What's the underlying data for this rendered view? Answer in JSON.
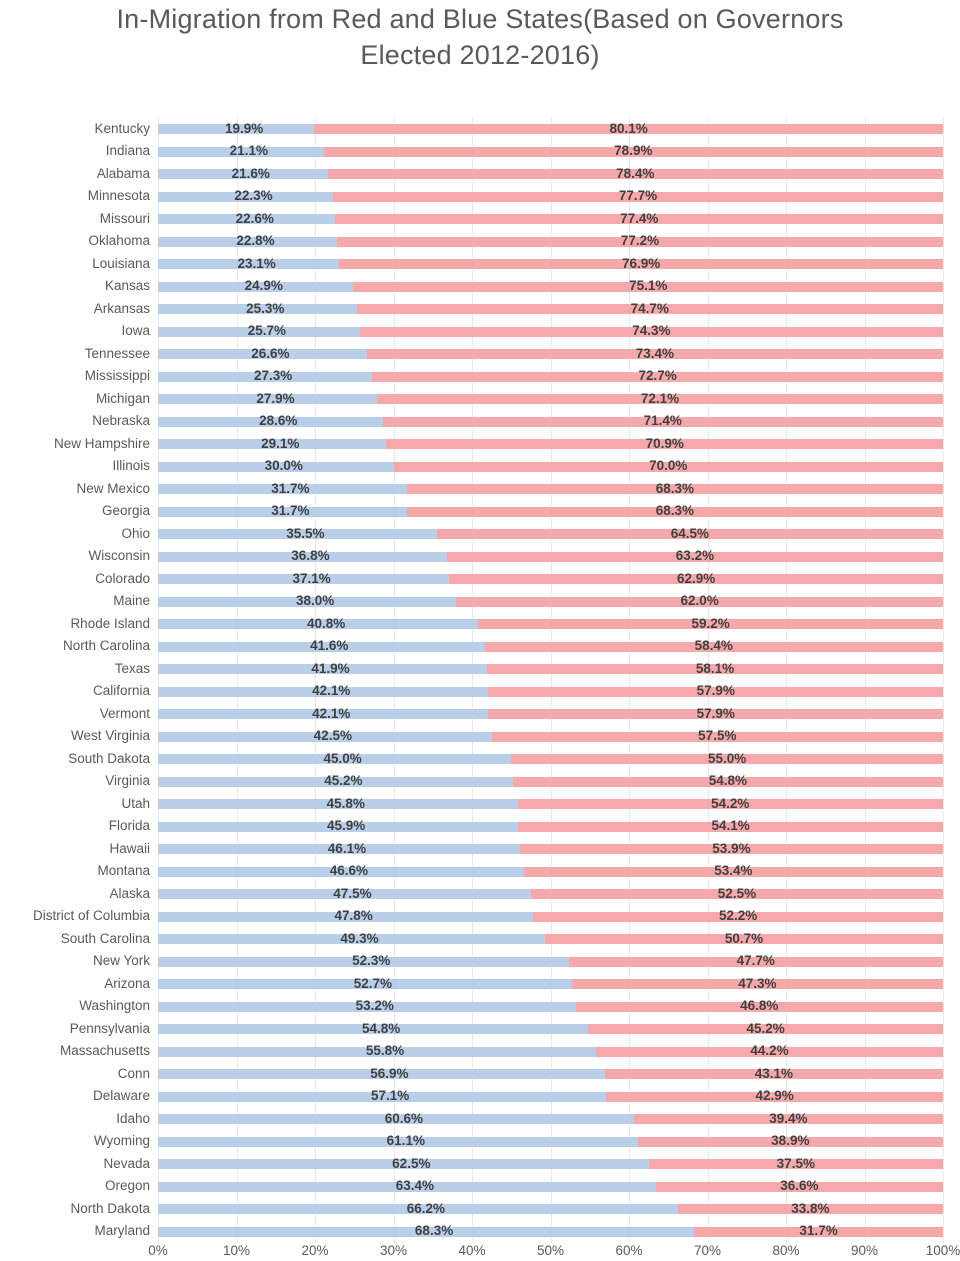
{
  "chart_data": {
    "type": "bar",
    "subtype": "100% stacked horizontal bar",
    "title": "In-Migration from Red and Blue States(Based on Governors Elected 2012-2016)",
    "xlabel": "",
    "ylabel": "",
    "xlim": [
      0,
      100
    ],
    "xticks": [
      "0%",
      "10%",
      "20%",
      "30%",
      "40%",
      "50%",
      "60%",
      "70%",
      "80%",
      "90%",
      "100%"
    ],
    "grid": true,
    "legend": "none",
    "series": [
      {
        "name": "Blue states",
        "color": "#b9cfe9"
      },
      {
        "name": "Red states",
        "color": "#f7a8ab"
      }
    ],
    "categories": [
      "Kentucky",
      "Indiana",
      "Alabama",
      "Minnesota",
      "Missouri",
      "Oklahoma",
      "Louisiana",
      "Kansas",
      "Arkansas",
      "Iowa",
      "Tennessee",
      "Mississippi",
      "Michigan",
      "Nebraska",
      "New Hampshire",
      "Illinois",
      "New Mexico",
      "Georgia",
      "Ohio",
      "Wisconsin",
      "Colorado",
      "Maine",
      "Rhode Island",
      "North Carolina",
      "Texas",
      "California",
      "Vermont",
      "West Virginia",
      "South Dakota",
      "Virginia",
      "Utah",
      "Florida",
      "Hawaii",
      "Montana",
      "Alaska",
      "District of Columbia",
      "South Carolina",
      "New York",
      "Arizona",
      "Washington",
      "Pennsylvania",
      "Massachusetts",
      "Conn",
      "Delaware",
      "Idaho",
      "Wyoming",
      "Nevada",
      "Oregon",
      "North Dakota",
      "Maryland"
    ],
    "blue_values": [
      19.9,
      21.1,
      21.6,
      22.3,
      22.6,
      22.8,
      23.1,
      24.9,
      25.3,
      25.7,
      26.6,
      27.3,
      27.9,
      28.6,
      29.1,
      30.0,
      31.7,
      31.7,
      35.5,
      36.8,
      37.1,
      38.0,
      40.8,
      41.6,
      41.9,
      42.1,
      42.1,
      42.5,
      45.0,
      45.2,
      45.8,
      45.9,
      46.1,
      46.6,
      47.5,
      47.8,
      49.3,
      52.3,
      52.7,
      53.2,
      54.8,
      55.8,
      56.9,
      57.1,
      60.6,
      61.1,
      62.5,
      63.4,
      66.2,
      68.3
    ],
    "red_values": [
      80.1,
      78.9,
      78.4,
      77.7,
      77.4,
      77.2,
      76.9,
      75.1,
      74.7,
      74.3,
      73.4,
      72.7,
      72.1,
      71.4,
      70.9,
      70.0,
      68.3,
      68.3,
      64.5,
      63.2,
      62.9,
      62.0,
      59.2,
      58.4,
      58.1,
      57.9,
      57.9,
      57.5,
      55.0,
      54.8,
      54.2,
      54.1,
      53.9,
      53.4,
      52.5,
      52.2,
      50.7,
      47.7,
      47.3,
      46.8,
      45.2,
      44.2,
      43.1,
      42.9,
      39.4,
      38.9,
      37.5,
      36.6,
      33.8,
      31.7
    ],
    "blue_labels": [
      "19.9%",
      "21.1%",
      "21.6%",
      "22.3%",
      "22.6%",
      "22.8%",
      "23.1%",
      "24.9%",
      "25.3%",
      "25.7%",
      "26.6%",
      "27.3%",
      "27.9%",
      "28.6%",
      "29.1%",
      "30.0%",
      "31.7%",
      "31.7%",
      "35.5%",
      "36.8%",
      "37.1%",
      "38.0%",
      "40.8%",
      "41.6%",
      "41.9%",
      "42.1%",
      "42.1%",
      "42.5%",
      "45.0%",
      "45.2%",
      "45.8%",
      "45.9%",
      "46.1%",
      "46.6%",
      "47.5%",
      "47.8%",
      "49.3%",
      "52.3%",
      "52.7%",
      "53.2%",
      "54.8%",
      "55.8%",
      "56.9%",
      "57.1%",
      "60.6%",
      "61.1%",
      "62.5%",
      "63.4%",
      "66.2%",
      "68.3%"
    ],
    "red_labels": [
      "80.1%",
      "78.9%",
      "78.4%",
      "77.7%",
      "77.4%",
      "77.2%",
      "76.9%",
      "75.1%",
      "74.7%",
      "74.3%",
      "73.4%",
      "72.7%",
      "72.1%",
      "71.4%",
      "70.9%",
      "70.0%",
      "68.3%",
      "68.3%",
      "64.5%",
      "63.2%",
      "62.9%",
      "62.0%",
      "59.2%",
      "58.4%",
      "58.1%",
      "57.9%",
      "57.9%",
      "57.5%",
      "55.0%",
      "54.8%",
      "54.2%",
      "54.1%",
      "53.9%",
      "53.4%",
      "52.5%",
      "52.2%",
      "50.7%",
      "47.7%",
      "47.3%",
      "46.8%",
      "45.2%",
      "44.2%",
      "43.1%",
      "42.9%",
      "39.4%",
      "38.9%",
      "37.5%",
      "36.6%",
      "33.8%",
      "31.7%"
    ]
  }
}
